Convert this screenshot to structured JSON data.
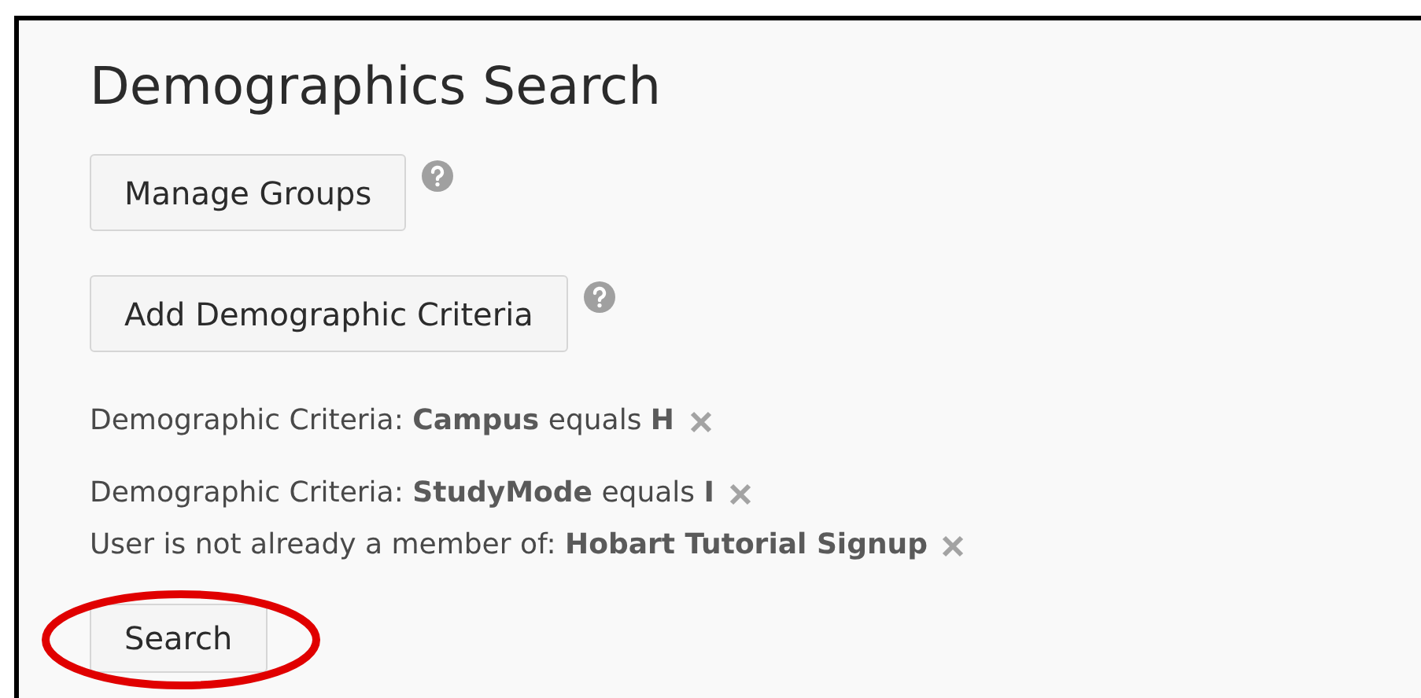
{
  "title": "Demographics Search",
  "actions": [
    {
      "label": "Manage Groups",
      "help": true
    },
    {
      "label": "Add Demographic Criteria",
      "help": true
    }
  ],
  "criteria_groups": [
    {
      "lines": [
        "Demographic Criteria: **Campus** equals **H**"
      ]
    },
    {
      "lines": [
        "Demographic Criteria: **StudyMode** equals **I**",
        "User is not already a member of: **Hobart Tutorial Signup**"
      ]
    }
  ],
  "search_button": {
    "label": "Search",
    "highlighted": true
  }
}
